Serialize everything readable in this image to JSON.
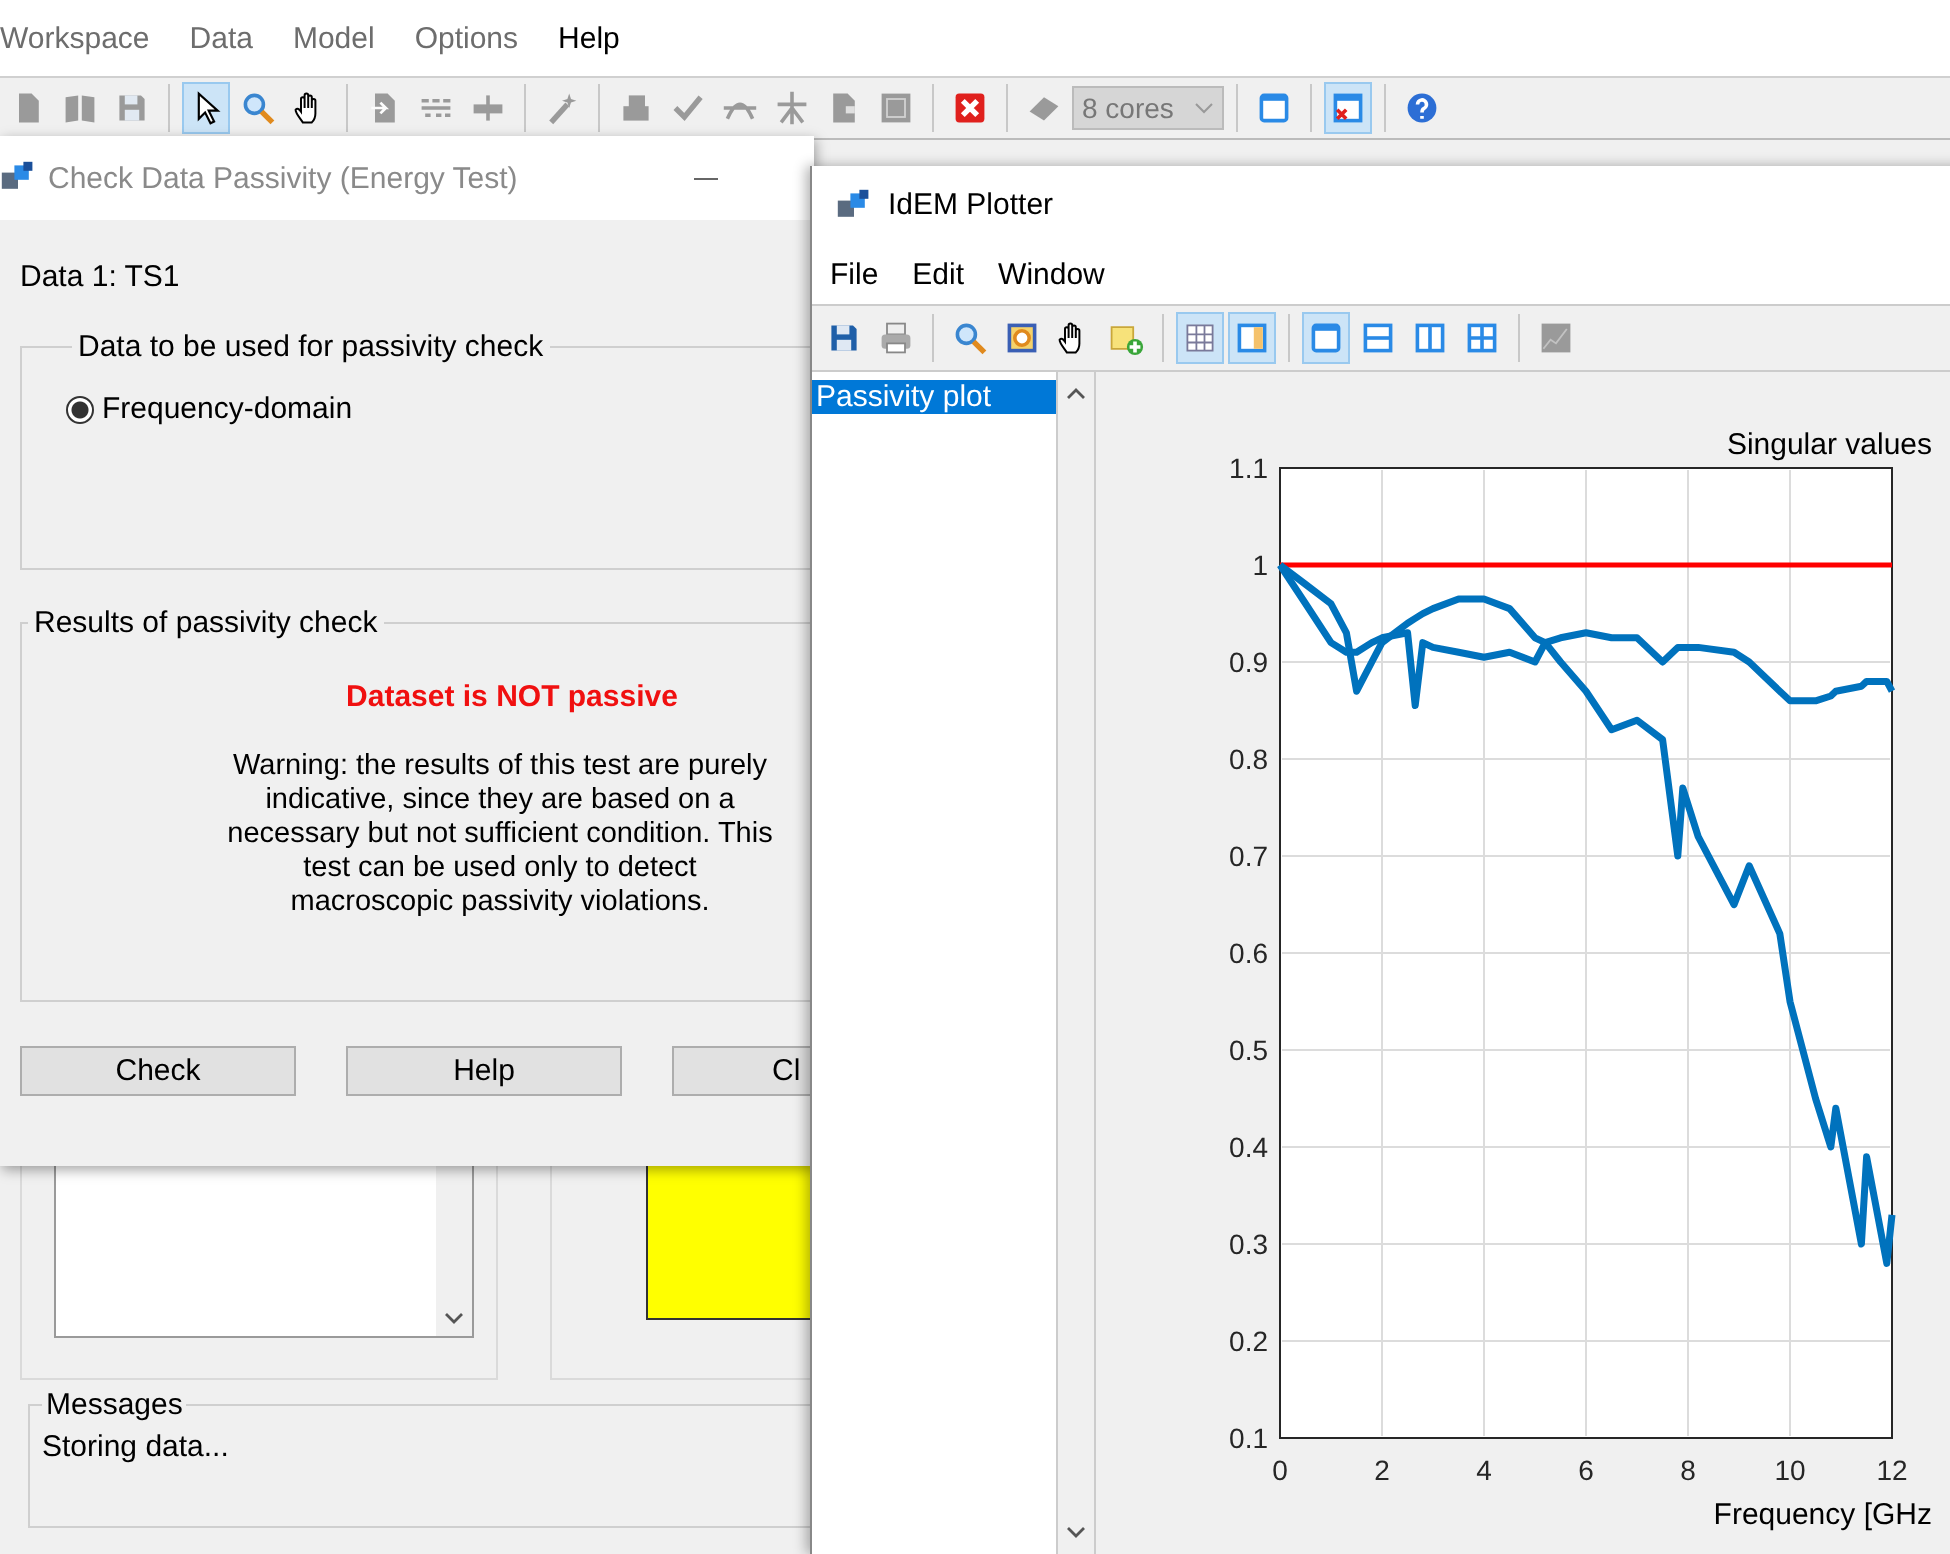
{
  "main_window": {
    "menu": [
      {
        "label": "Workspace",
        "disabled": true
      },
      {
        "label": "Data",
        "disabled": true
      },
      {
        "label": "Model",
        "disabled": true
      },
      {
        "label": "Options",
        "disabled": true
      },
      {
        "label": "Help",
        "disabled": false
      }
    ],
    "toolbar": [
      {
        "kind": "button",
        "selected": false,
        "disabled": true
      },
      {
        "kind": "button",
        "selected": false,
        "disabled": true
      },
      {
        "kind": "button",
        "selected": false,
        "disabled": true
      },
      {
        "kind": "separator"
      },
      {
        "kind": "button",
        "selected": true,
        "disabled": false
      },
      {
        "kind": "button",
        "selected": false,
        "disabled": false
      },
      {
        "kind": "button",
        "selected": false,
        "disabled": false
      },
      {
        "kind": "separator"
      },
      {
        "kind": "button",
        "selected": false,
        "disabled": true
      },
      {
        "kind": "button",
        "selected": false,
        "disabled": true
      },
      {
        "kind": "button",
        "selected": false,
        "disabled": true
      },
      {
        "kind": "separator"
      },
      {
        "kind": "button",
        "selected": false,
        "disabled": true
      },
      {
        "kind": "separator"
      },
      {
        "kind": "button",
        "selected": false,
        "disabled": true
      },
      {
        "kind": "button",
        "selected": false,
        "disabled": true
      },
      {
        "kind": "button",
        "selected": false,
        "disabled": true
      },
      {
        "kind": "button",
        "selected": false,
        "disabled": true
      },
      {
        "kind": "button",
        "selected": false,
        "disabled": true
      },
      {
        "kind": "button",
        "selected": false,
        "disabled": true
      },
      {
        "kind": "separator"
      },
      {
        "kind": "button",
        "selected": false,
        "disabled": false
      },
      {
        "kind": "separator"
      },
      {
        "kind": "button",
        "selected": false,
        "disabled": true
      },
      {
        "kind": "combo",
        "value": "8 cores",
        "disabled": true
      },
      {
        "kind": "separator"
      },
      {
        "kind": "button",
        "selected": false,
        "disabled": false
      },
      {
        "kind": "separator"
      },
      {
        "kind": "button",
        "selected": true,
        "disabled": false
      },
      {
        "kind": "separator"
      },
      {
        "kind": "button",
        "selected": false,
        "disabled": false
      }
    ],
    "status_indicator": {
      "color": "#ffff00"
    },
    "messages": {
      "title": "Messages",
      "lines": [
        "Storing data..."
      ]
    }
  },
  "passivity_dialog": {
    "title": "Check Data Passivity (Energy Test)",
    "active": false,
    "data_label": "Data 1: TS1",
    "data_group": {
      "title": "Data to be used for passivity check",
      "options": [
        {
          "label": "Frequency-domain",
          "selected": true
        }
      ]
    },
    "results_group": {
      "title": "Results of passivity check",
      "verdict": "Dataset is NOT passive",
      "passive": false,
      "warning": "Warning: the results of this test are purely indicative, since they are based on a necessary but not sufficient condition. This test can be used only to detect macroscopic passivity violations."
    },
    "buttons": [
      "Check",
      "Help",
      "Cl"
    ]
  },
  "plotter": {
    "title": "IdEM Plotter",
    "menu": [
      "File",
      "Edit",
      "Window"
    ],
    "toolbar": [
      {
        "kind": "button",
        "selected": false,
        "disabled": false
      },
      {
        "kind": "button",
        "selected": false,
        "disabled": false
      },
      {
        "kind": "separator"
      },
      {
        "kind": "button",
        "selected": false,
        "disabled": false
      },
      {
        "kind": "button",
        "selected": false,
        "disabled": false
      },
      {
        "kind": "button",
        "selected": false,
        "disabled": false
      },
      {
        "kind": "button",
        "selected": false,
        "disabled": false
      },
      {
        "kind": "separator"
      },
      {
        "kind": "button",
        "selected": true,
        "disabled": false
      },
      {
        "kind": "button",
        "selected": true,
        "disabled": false
      },
      {
        "kind": "separator"
      },
      {
        "kind": "button",
        "selected": true,
        "disabled": false
      },
      {
        "kind": "button",
        "selected": false,
        "disabled": false
      },
      {
        "kind": "button",
        "selected": false,
        "disabled": false
      },
      {
        "kind": "button",
        "selected": false,
        "disabled": false
      },
      {
        "kind": "separator"
      },
      {
        "kind": "button",
        "selected": false,
        "disabled": true
      }
    ],
    "plots": [
      {
        "label": "Passivity plot",
        "selected": true
      }
    ],
    "chart_data": {
      "type": "line",
      "grid": true,
      "title": "Singular values",
      "xlabel": "Frequency [GHz",
      "xlim": [
        0,
        12
      ],
      "ylim": [
        0.1,
        1.1
      ],
      "xticks": [
        0,
        2,
        4,
        6,
        8,
        10,
        12
      ],
      "yticks": [
        0.1,
        0.2,
        0.3,
        0.4,
        0.5,
        0.6,
        0.7,
        0.8,
        0.9,
        1,
        1.1
      ],
      "x": [
        0,
        0.5,
        1,
        1.3,
        1.5,
        1.8,
        2,
        2.5,
        2.65,
        2.8,
        3,
        3.5,
        4,
        4.5,
        5,
        5.2,
        5.5,
        6,
        6.5,
        7,
        7.5,
        7.8,
        7.9,
        8.2,
        8.9,
        9.2,
        9.8,
        10,
        10.5,
        10.8,
        10.9,
        11.4,
        11.5,
        11.9,
        12
      ],
      "series": [
        {
          "color": "#ff0000",
          "values": [
            1,
            1,
            1,
            1,
            1,
            1,
            1,
            1,
            1,
            1,
            1,
            1,
            1,
            1,
            1,
            1,
            1,
            1,
            1,
            1,
            1,
            1,
            1,
            1,
            1,
            1,
            1,
            1,
            1,
            1,
            1,
            1,
            1,
            1,
            1
          ]
        },
        {
          "color": "#0072bd",
          "values": [
            1,
            0.98,
            0.96,
            0.93,
            0.87,
            0.9,
            0.92,
            0.94,
            0.945,
            0.95,
            0.955,
            0.965,
            0.965,
            0.955,
            0.925,
            0.92,
            0.9,
            0.87,
            0.83,
            0.84,
            0.82,
            0.7,
            0.77,
            0.72,
            0.65,
            0.69,
            0.62,
            0.55,
            0.45,
            0.4,
            0.44,
            0.3,
            0.39,
            0.28,
            0.33
          ]
        },
        {
          "color": "#0072bd",
          "values": [
            1,
            0.96,
            0.92,
            0.91,
            0.91,
            0.92,
            0.925,
            0.93,
            0.855,
            0.92,
            0.915,
            0.91,
            0.905,
            0.91,
            0.9,
            0.92,
            0.925,
            0.93,
            0.925,
            0.925,
            0.9,
            0.915,
            0.915,
            0.915,
            0.91,
            0.9,
            0.87,
            0.86,
            0.86,
            0.865,
            0.87,
            0.875,
            0.88,
            0.88,
            0.87
          ]
        }
      ]
    }
  }
}
